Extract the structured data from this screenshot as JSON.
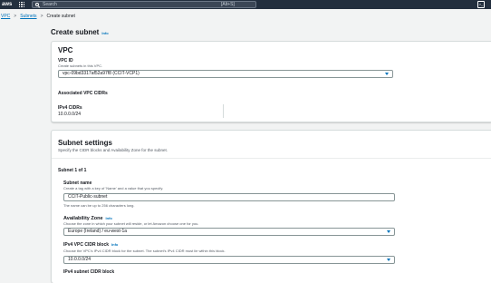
{
  "topbar": {
    "logo": "aws",
    "search_placeholder": "Search",
    "search_shortcut": "[Alt+S]",
    "icons": [
      "grid-icon",
      "search-icon",
      "terminal-icon"
    ]
  },
  "breadcrumb": {
    "vpc": "VPC",
    "subnets": "Subnets",
    "current": "Create subnet"
  },
  "page": {
    "title": "Create subnet",
    "info": "Info"
  },
  "vpc_panel": {
    "heading": "VPC",
    "vpc_id_label": "VPC ID",
    "vpc_id_desc": "Create subnets in this VPC.",
    "vpc_id_value": "vpc-09bd3317af52a97f8 (CCIT-VCP1)",
    "assoc_label": "Associated VPC CIDRs",
    "ipv4_label": "IPv4 CIDRs",
    "ipv4_value": "10.0.0.0/24"
  },
  "subnet_panel": {
    "heading": "Subnet settings",
    "desc": "Specify the CIDR blocks and Availability Zone for the subnet.",
    "subnet_index": "Subnet 1 of 1",
    "name_label": "Subnet name",
    "name_desc": "Create a tag with a key of 'Name' and a value that you specify.",
    "name_value": "CCIT-Public-subnet",
    "name_hint": "The name can be up to 256 characters long.",
    "az_label": "Availability Zone",
    "az_info": "Info",
    "az_desc": "Choose the zone in which your subnet will reside, or let Amazon choose one for you.",
    "az_value": "Europe (Ireland) / eu-west-1a",
    "vpc_cidr_label": "IPv4 VPC CIDR block",
    "vpc_cidr_info": "Info",
    "vpc_cidr_desc": "Choose the VPC's IPv4 CIDR block for the subnet. The subnet's IPv4 CIDR must lie within this block.",
    "vpc_cidr_value": "10.0.0.0/24",
    "subnet_cidr_label": "IPv4 subnet CIDR block"
  }
}
